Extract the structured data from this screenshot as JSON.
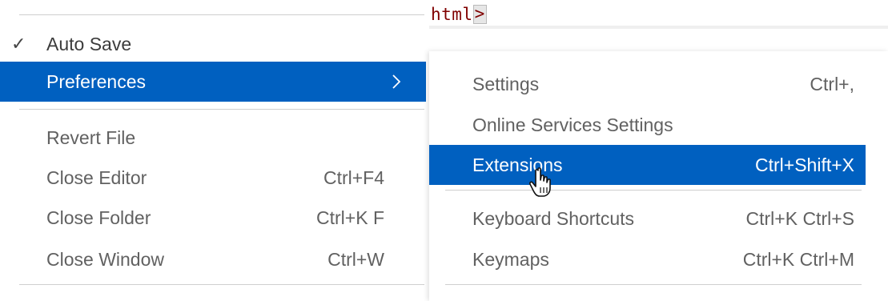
{
  "left_menu": {
    "items": [
      {
        "label": "Auto Save",
        "checked": "✓",
        "shortcut": ""
      },
      {
        "label": "Preferences",
        "shortcut": ""
      },
      {
        "label": "Revert File",
        "shortcut": ""
      },
      {
        "label": "Close Editor",
        "shortcut": "Ctrl+F4"
      },
      {
        "label": "Close Folder",
        "shortcut": "Ctrl+K F"
      },
      {
        "label": "Close Window",
        "shortcut": "Ctrl+W"
      }
    ]
  },
  "editor": {
    "code_text": "html",
    "bracket": ">"
  },
  "submenu": {
    "items": [
      {
        "label": "Settings",
        "shortcut": "Ctrl+,"
      },
      {
        "label": "Online Services Settings",
        "shortcut": ""
      },
      {
        "label": "Extensions",
        "shortcut": "Ctrl+Shift+X"
      },
      {
        "label": "Keyboard Shortcuts",
        "shortcut": "Ctrl+K Ctrl+S"
      },
      {
        "label": "Keymaps",
        "shortcut": "Ctrl+K Ctrl+M"
      }
    ]
  },
  "colors": {
    "selection": "#0060c0",
    "text": "#616161",
    "separator": "#cfcfcf"
  },
  "icons": {
    "submenu_arrow": "chevron-right-icon",
    "checkmark": "checkmark-icon",
    "cursor": "hand-pointer-icon"
  }
}
